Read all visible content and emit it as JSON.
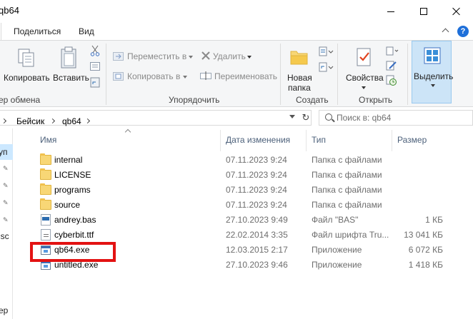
{
  "window": {
    "title": "qb64"
  },
  "ribbon_tabs": [
    "Поделиться",
    "Вид"
  ],
  "ribbon": {
    "clipboard": {
      "copy_label": "Копировать",
      "paste_label": "Вставить",
      "group_label": "ер обмена"
    },
    "organize": {
      "move_label": "Переместить в",
      "copy_to_label": "Копировать в",
      "delete_label": "Удалить",
      "rename_label": "Переименовать",
      "group_label": "Упорядочить"
    },
    "create": {
      "new_folder_line1": "Новая",
      "new_folder_line2": "папка",
      "group_label": "Создать"
    },
    "open": {
      "properties_label": "Свойства",
      "group_label": "Открыть"
    },
    "select": {
      "select_label": "Выделить"
    }
  },
  "address": {
    "breadcrumbs": [
      "Бейсик",
      "qb64"
    ],
    "search_placeholder": "Поиск в: qb64"
  },
  "nav": {
    "items": [
      "уп",
      "jsc",
      "ер"
    ]
  },
  "columns": {
    "name": "Имя",
    "date": "Дата изменения",
    "type": "Тип",
    "size": "Размер"
  },
  "files": [
    {
      "name": "internal",
      "date": "07.11.2023 9:24",
      "type": "Папка с файлами",
      "size": "",
      "icon": "folder"
    },
    {
      "name": "LICENSE",
      "date": "07.11.2023 9:24",
      "type": "Папка с файлами",
      "size": "",
      "icon": "folder"
    },
    {
      "name": "programs",
      "date": "07.11.2023 9:24",
      "type": "Папка с файлами",
      "size": "",
      "icon": "folder"
    },
    {
      "name": "source",
      "date": "07.11.2023 9:24",
      "type": "Папка с файлами",
      "size": "",
      "icon": "folder"
    },
    {
      "name": "andrey.bas",
      "date": "27.10.2023 9:49",
      "type": "Файл \"BAS\"",
      "size": "1 КБ",
      "icon": "bas"
    },
    {
      "name": "cyberbit.ttf",
      "date": "22.02.2014 3:35",
      "type": "Файл шрифта Tru...",
      "size": "13 041 КБ",
      "icon": "ttf"
    },
    {
      "name": "qb64.exe",
      "date": "12.03.2015 2:17",
      "type": "Приложение",
      "size": "6 072 КБ",
      "icon": "exe"
    },
    {
      "name": "untitled.exe",
      "date": "27.10.2023 9:46",
      "type": "Приложение",
      "size": "1 418 КБ",
      "icon": "exe"
    }
  ],
  "colors": {
    "highlight_box": "#e31212",
    "selection": "#cce4f7",
    "folder": "#f8d776"
  }
}
